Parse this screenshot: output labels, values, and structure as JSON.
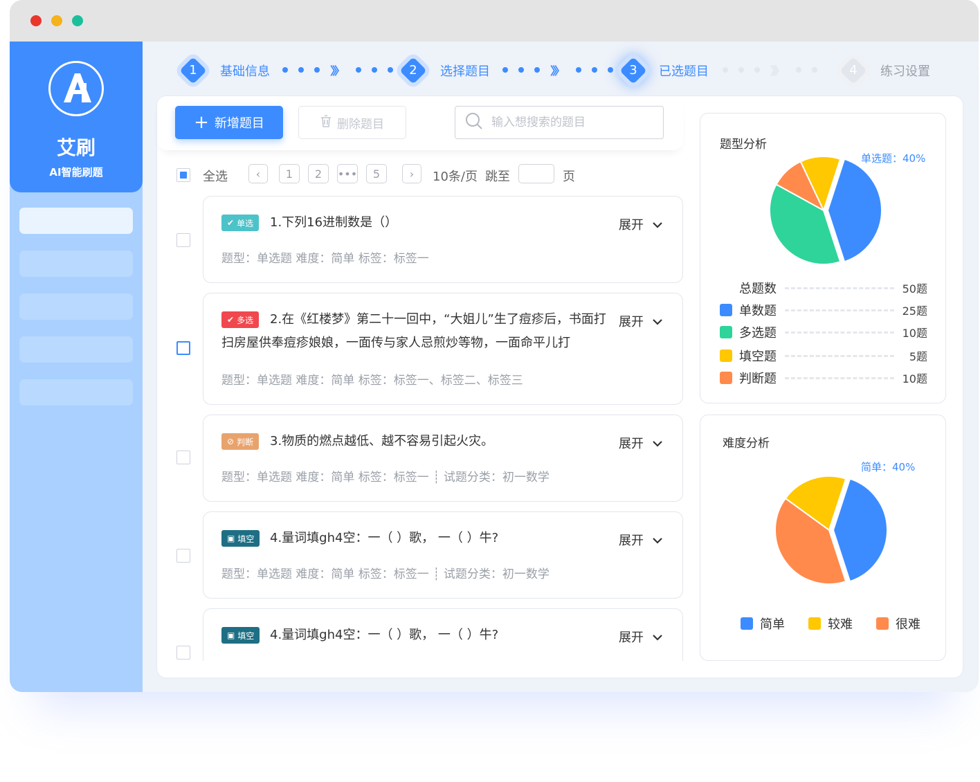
{
  "brand": {
    "name": "艾刷",
    "subtitle": "AI智能刷题"
  },
  "steps": [
    {
      "num": "1",
      "label": "基础信息",
      "state": "done"
    },
    {
      "num": "2",
      "label": "选择题目",
      "state": "done"
    },
    {
      "num": "3",
      "label": "已选题目",
      "state": "active"
    },
    {
      "num": "4",
      "label": "练习设置",
      "state": "pending"
    }
  ],
  "toolbar": {
    "add_label": "新增题目",
    "delete_label": "删除题目",
    "search_placeholder": "输入想搜索的题目"
  },
  "pagination": {
    "select_all": "全选",
    "pages": [
      "1",
      "2",
      "5"
    ],
    "page_size": "10条/页",
    "jump_label": "跳至",
    "page_suffix": "页"
  },
  "questions": [
    {
      "tag": "单选",
      "tag_color": "#4cc2c9",
      "text": "1.下列16进制数是（）",
      "meta": "题型：单选题    难度：简单    标签：标签一",
      "expand": "展开"
    },
    {
      "tag": "多选",
      "tag_color": "#f0484e",
      "text": "2.在《红楼梦》第二十一回中，“大姐儿”生了痘疹后，书面打扫房屋供奉痘疹娘娘，一面传与家人忌煎炒等物，一面命平儿打",
      "meta": "题型：单选题    难度：简单    标签：标签一、标签二、标签三",
      "expand": "展开"
    },
    {
      "tag": "判断",
      "tag_color": "#e8a36d",
      "text": "3.物质的燃点越低、越不容易引起火灾。",
      "meta": "题型：单选题    难度：简单    标签：标签一 ┊ 试题分类：初一数学",
      "expand": "展开"
    },
    {
      "tag": "填空",
      "tag_color": "#1e6f84",
      "text": "4.量词填gh4空：一（    ）歌，  一（    ）牛?",
      "meta": "题型：单选题    难度：简单    标签：标签一 ┊ 试题分类：初一数学",
      "expand": "展开"
    },
    {
      "tag": "填空",
      "tag_color": "#1e6f84",
      "text": "4.量词填gh4空：一（    ）歌，  一（    ）牛?",
      "meta": "",
      "expand": "展开"
    }
  ],
  "type_analysis": {
    "title": "题型分析",
    "callout": "单选题：40%",
    "total_label": "总题数",
    "total_value": "50题",
    "rows": [
      {
        "label": "单数题",
        "value": "25题",
        "color": "#3c8cff"
      },
      {
        "label": "多选题",
        "value": "10题",
        "color": "#2fd49a"
      },
      {
        "label": "填空题",
        "value": "5题",
        "color": "#ffc800"
      },
      {
        "label": "判断题",
        "value": "10题",
        "color": "#ff8a4c"
      }
    ],
    "slices": [
      {
        "name": "单数题",
        "percent": 40,
        "color": "#3c8cff"
      },
      {
        "name": "多选题",
        "percent": 38,
        "color": "#2fd49a"
      },
      {
        "name": "判断题",
        "percent": 10,
        "color": "#ff8a4c"
      },
      {
        "name": "填空题",
        "percent": 12,
        "color": "#ffc800"
      }
    ]
  },
  "difficulty_analysis": {
    "title": "难度分析",
    "callout": "简单：40%",
    "legend": [
      {
        "label": "简单",
        "color": "#3c8cff"
      },
      {
        "label": "较难",
        "color": "#ffc800"
      },
      {
        "label": "很难",
        "color": "#ff8a4c"
      }
    ],
    "slices": [
      {
        "name": "简单",
        "percent": 40,
        "color": "#3c8cff"
      },
      {
        "name": "很难",
        "percent": 40,
        "color": "#ff8a4c"
      },
      {
        "name": "较难",
        "percent": 20,
        "color": "#ffc800"
      }
    ]
  }
}
